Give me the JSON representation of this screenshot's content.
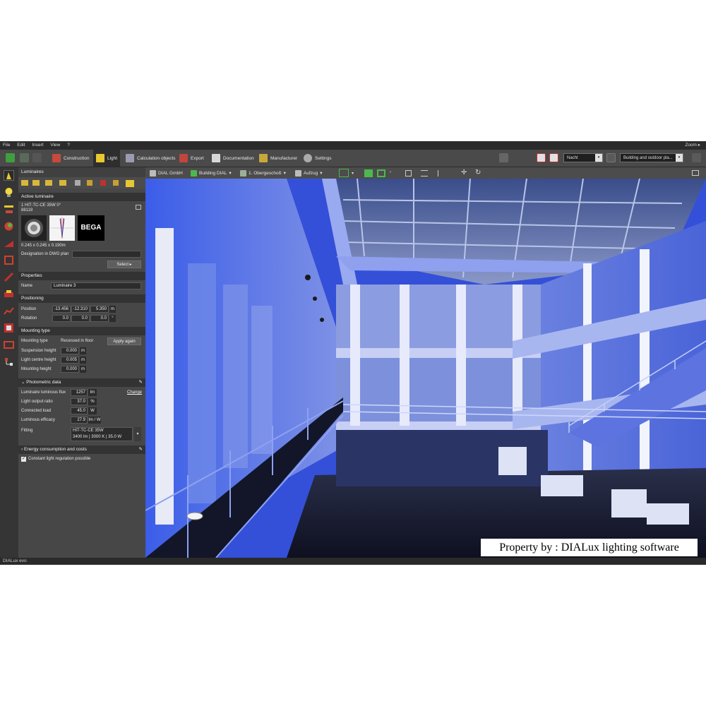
{
  "menu": {
    "items": [
      "File",
      "Edit",
      "Insert",
      "View",
      "?"
    ],
    "zoom": "Zoom ▸"
  },
  "toolbar": {
    "tabs": [
      {
        "label": "Construction"
      },
      {
        "label": "Light"
      },
      {
        "label": "Calculation objects"
      },
      {
        "label": "Export"
      },
      {
        "label": "Documentation"
      },
      {
        "label": "Manufacturer"
      },
      {
        "label": "Settings"
      }
    ],
    "scene_select": "Nacht",
    "mode_select": "Building and outdoor pla...",
    "scene_arrow": "▾",
    "mode_arrow": "▾"
  },
  "panel": {
    "title": "Luminaires",
    "active_luminaire_header": "Active luminaire",
    "luminaire_name": "1 HIT-TC-CE 35W 0°",
    "luminaire_code": "88119",
    "brand": "BEGA",
    "dimensions": "0.245 x 0.245 x 0.190m",
    "designation_label": "Designation in DWG plan",
    "select_button": "Select",
    "properties_header": "Properties",
    "name_label": "Name",
    "name_value": "Luminaire 3",
    "positioning_header": "Positioning",
    "position_label": "Position",
    "position": [
      "-13.456",
      "-12.310",
      "5.350"
    ],
    "position_unit": "m",
    "rotation_label": "Rotation",
    "rotation": [
      "0.0",
      "0.0",
      "0.0"
    ],
    "rotation_unit": "°",
    "mounting_header": "Mounting type",
    "mounting_type_label": "Mounting type",
    "mounting_type_value": "Recessed in floor",
    "apply_button": "Apply again",
    "suspension_label": "Suspension height",
    "suspension_value": "0.000",
    "light_centre_label": "Light centre height",
    "light_centre_value": "0.005",
    "mounting_height_label": "Mounting height",
    "mounting_height_value": "0.000",
    "unit_m": "m",
    "photometric_header": "Photometric data",
    "flux_label": "Luminaire luminous flux",
    "flux_value": "1257",
    "flux_unit": "lm",
    "change_link": "Change",
    "lor_label": "Light output ratio",
    "lor_value": "37.0",
    "lor_unit": "%",
    "load_label": "Connected load",
    "load_value": "45.0",
    "load_unit": "W",
    "efficacy_label": "Luminous efficacy",
    "efficacy_value": "27.9",
    "efficacy_unit": "lm / W",
    "fitting_label": "Fitting",
    "fitting_line1": "HIT-TC-CE  35W",
    "fitting_line2": "3400 lm  |  3000 K  |  35.0 W",
    "energy_header": "Energy consumption and costs",
    "constant_light_label": "Constant light regulation possible",
    "constant_light_checked": true
  },
  "viewbar": {
    "items": [
      "DIAL GmbH",
      "Building DIAL",
      "1. Obergeschoß",
      "Aufzug"
    ]
  },
  "statusbar": {
    "app_name": "DIALux evo"
  },
  "watermark": "Property by : DIALux lighting software",
  "colors": {
    "accent_green": "#4db84d",
    "panel_bg": "#474747",
    "header_bg": "#333333",
    "viewport_blue": "#4a6cf0"
  }
}
